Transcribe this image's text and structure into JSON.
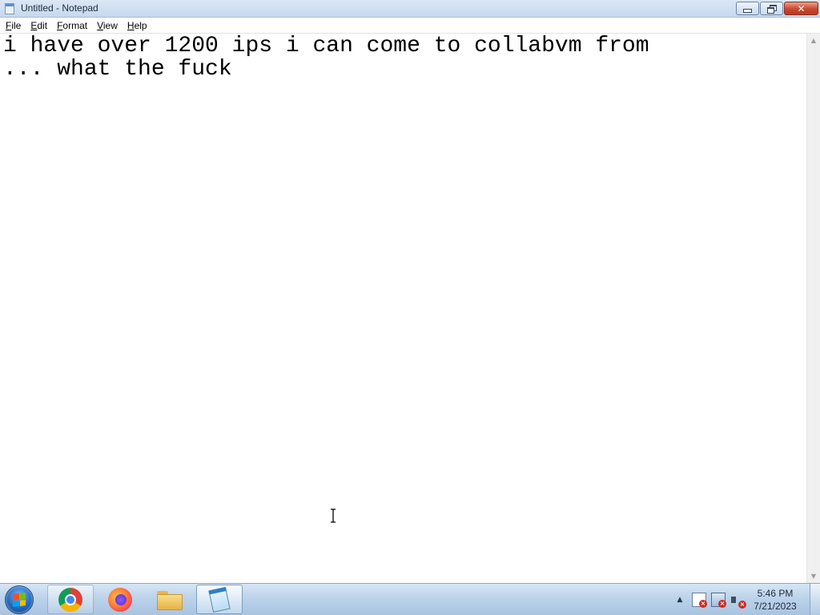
{
  "window": {
    "title": "Untitled - Notepad",
    "close_glyph": "✕"
  },
  "menu": [
    {
      "mnemonic": "F",
      "rest": "ile"
    },
    {
      "mnemonic": "E",
      "rest": "dit"
    },
    {
      "mnemonic": "F",
      "rest": "ormat"
    },
    {
      "mnemonic": "V",
      "rest": "iew"
    },
    {
      "mnemonic": "H",
      "rest": "elp"
    }
  ],
  "editor": {
    "text": "i have over 1200 ips i can come to collabvm from\n... what the fuck"
  },
  "scrollbar": {
    "up_glyph": "▲",
    "down_glyph": "▼"
  },
  "taskbar": {
    "apps": [
      "chrome-icon",
      "firefox-icon",
      "folder-icon",
      "notepad-icon"
    ],
    "tray_up_glyph": "▲",
    "tray_icons": [
      "action-center-flag-icon",
      "network-icon",
      "volume-muted-icon"
    ],
    "clock": {
      "time": "5:46 PM",
      "date": "7/21/2023"
    }
  }
}
